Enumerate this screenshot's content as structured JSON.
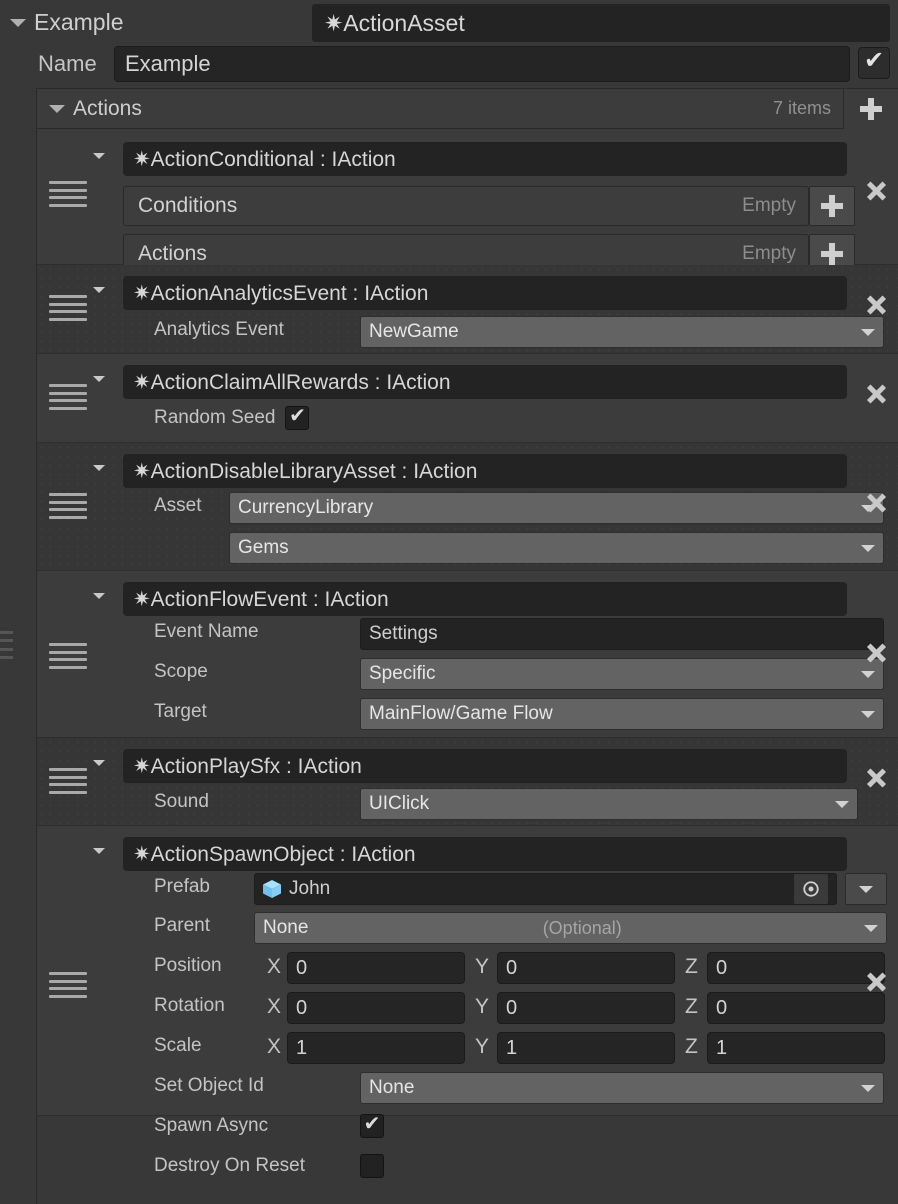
{
  "header": {
    "foldout_label": "Example",
    "type_label": "✷ActionAsset"
  },
  "name_row": {
    "label": "Name",
    "value": "Example",
    "enabled_checkbox": "✔"
  },
  "list": {
    "label": "Actions",
    "count": "7 items",
    "add_label": "+"
  },
  "actions": [
    {
      "type": "✷ActionConditional : IAction",
      "subfields": [
        {
          "label": "Conditions",
          "status": "Empty"
        },
        {
          "label": "Actions",
          "status": "Empty"
        }
      ]
    },
    {
      "type": "✷ActionAnalyticsEvent : IAction",
      "field_label": "Analytics Event",
      "field_value": "NewGame"
    },
    {
      "type": "✷ActionClaimAllRewards : IAction",
      "field_label": "Random Seed",
      "checked": "✔"
    },
    {
      "type": "✷ActionDisableLibraryAsset : IAction",
      "field_label": "Asset",
      "field_value": "CurrencyLibrary",
      "field_value2": "Gems"
    },
    {
      "type": "✷ActionFlowEvent : IAction",
      "rows": [
        {
          "label": "Event Name",
          "value": "Settings"
        },
        {
          "label": "Scope",
          "value": "Specific"
        },
        {
          "label": "Target",
          "value": "MainFlow/Game Flow"
        }
      ]
    },
    {
      "type": "✷ActionPlaySfx : IAction",
      "field_label": "Sound",
      "field_value": "UIClick"
    },
    {
      "type": "✷ActionSpawnObject : IAction",
      "prefab_label": "Prefab",
      "prefab_value": "John",
      "parent_label": "Parent",
      "parent_value": "None",
      "parent_hint": "(Optional)",
      "position_label": "Position",
      "rotation_label": "Rotation",
      "scale_label": "Scale",
      "axis_x": "X",
      "axis_y": "Y",
      "axis_z": "Z",
      "position": {
        "x": "0",
        "y": "0",
        "z": "0"
      },
      "rotation": {
        "x": "0",
        "y": "0",
        "z": "0"
      },
      "scale": {
        "x": "1",
        "y": "1",
        "z": "1"
      },
      "set_object_id_label": "Set Object Id",
      "set_object_id_value": "None",
      "spawn_async_label": "Spawn Async",
      "spawn_async_checked": "✔",
      "destroy_on_reset_label": "Destroy On Reset",
      "destroy_on_reset_checked": ""
    }
  ],
  "colors": {
    "background": "#383838",
    "row": "#3c3c3c",
    "row_alt": "#363636",
    "field_dark": "#232323",
    "field_grey": "#636363",
    "text": "#c8c8c8",
    "prefab_icon": "#8fd3f4"
  }
}
